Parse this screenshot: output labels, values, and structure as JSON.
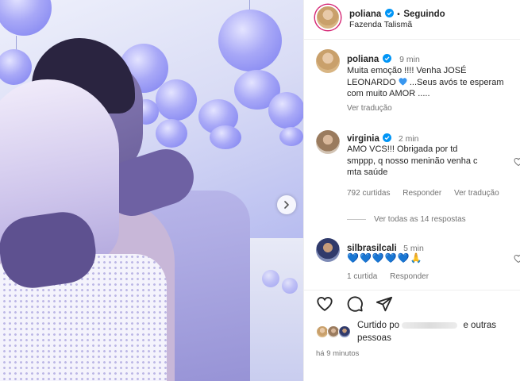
{
  "header": {
    "username": "poliana",
    "separator": "•",
    "follow_status": "Seguindo",
    "location": "Fazenda Talismã"
  },
  "comments": [
    {
      "username": "poliana",
      "time": "9 min",
      "text_line1": "Muita emoção !!!! Venha JOSÉ",
      "text_line2_pre": "LEONARDO",
      "text_line2_post": "...Seus avós te esperam",
      "text_line3": "com muito AMOR .....",
      "translate": "Ver tradução"
    },
    {
      "username": "virginia",
      "time": "2 min",
      "text_line1": "AMO VCS!!! Obrigada por td",
      "text_line2": "smppp, q nosso meninão venha c",
      "text_line3": "mta saúde",
      "likes": "792 curtidas",
      "reply": "Responder",
      "translate": "Ver tradução"
    },
    {
      "username": "silbrasilcali",
      "time": "5 min",
      "emoji_text": "💙💙💙💙💙🙏",
      "likes": "1 curtida",
      "reply": "Responder"
    }
  ],
  "view_replies": "Ver todas as 14 respostas",
  "liked_by": {
    "prefix": "Curtido po",
    "suffix": "e outras",
    "line2": "pessoas"
  },
  "timestamp": "há 9 minutos",
  "colors": {
    "verified_blue": "#0095f6",
    "heart_blue": "#3897f0"
  },
  "icons": [
    "verified-icon",
    "heart-icon",
    "comment-icon",
    "share-icon",
    "chevron-right-icon"
  ]
}
